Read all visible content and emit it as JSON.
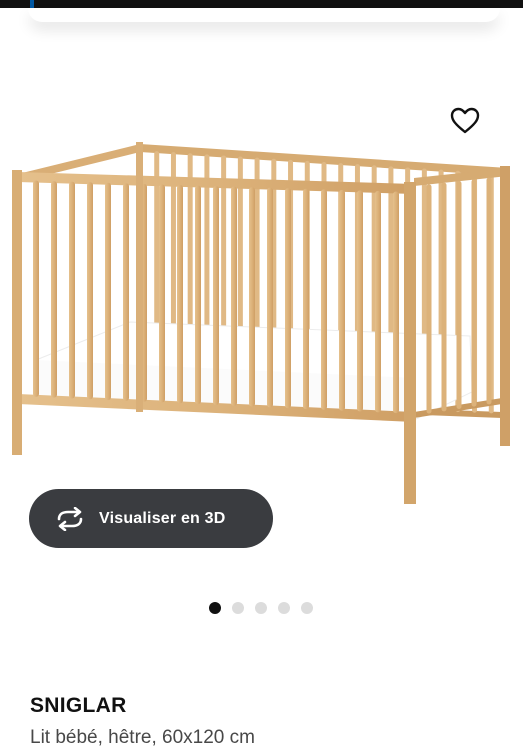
{
  "header": {
    "accent_color": "#0058a3"
  },
  "favorite": {
    "icon": "heart-outline-icon"
  },
  "product_image": {
    "alt": "SNIGLAR",
    "wood_color": "#ddb47f",
    "mattress_color": "#ffffff"
  },
  "view3d_button": {
    "label": "Visualiser en 3D",
    "icon": "rotate-3d-icon",
    "background": "#3a3c40"
  },
  "carousel": {
    "total": 5,
    "active_index": 1
  },
  "product": {
    "name": "SNIGLAR",
    "description": "Lit bébé, hêtre, 60x120 cm"
  }
}
